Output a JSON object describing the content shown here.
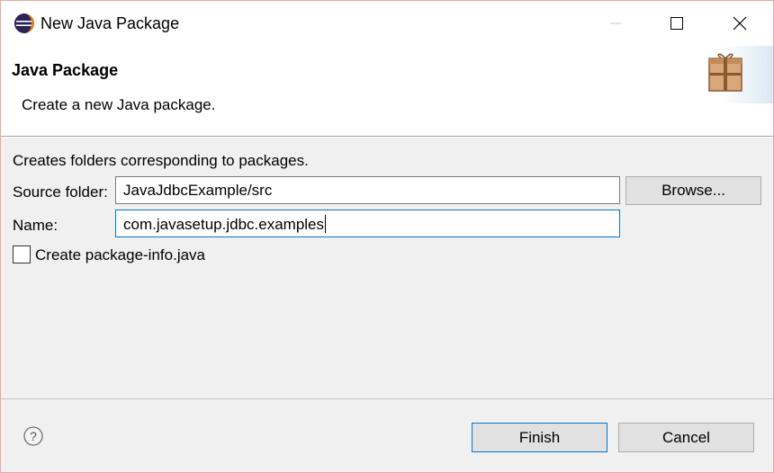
{
  "window": {
    "title": "New Java Package"
  },
  "banner": {
    "title": "Java Package",
    "description": "Create a new Java package."
  },
  "form": {
    "info": "Creates folders corresponding to packages.",
    "source_folder_label": "Source folder:",
    "source_folder_value": "JavaJdbcExample/src",
    "browse_label": "Browse...",
    "name_label": "Name:",
    "name_value": "com.javasetup.jdbc.examples",
    "create_package_info_label": "Create package-info.java",
    "create_package_info_checked": false
  },
  "footer": {
    "finish_label": "Finish",
    "cancel_label": "Cancel"
  },
  "icons": {
    "app": "eclipse-icon",
    "banner": "package-icon",
    "help": "help-icon"
  },
  "colors": {
    "accent": "#0078d7",
    "dialog_bg": "#f0f0f0",
    "button_bg": "#e1e1e1"
  }
}
